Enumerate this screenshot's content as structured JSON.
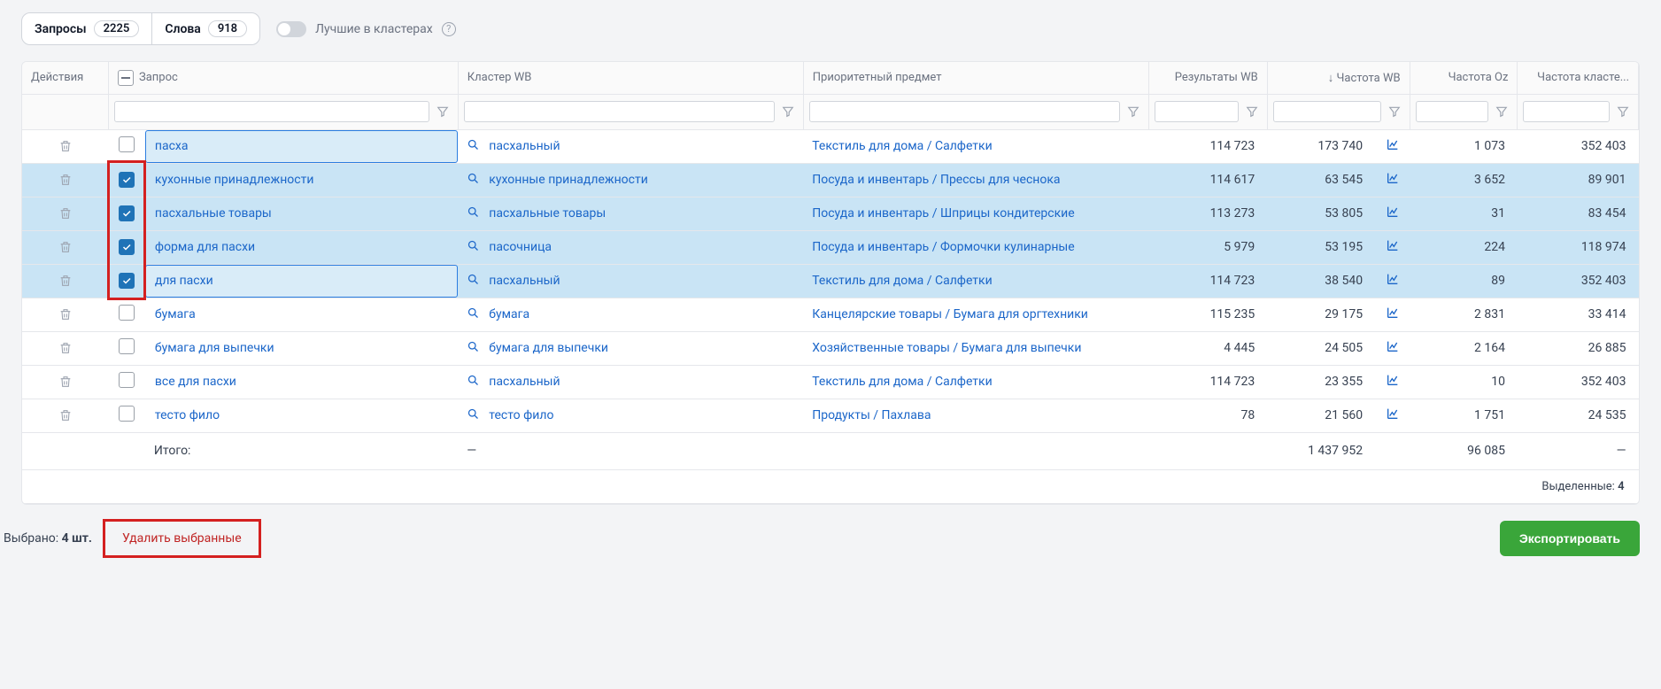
{
  "toolbar": {
    "queries_label": "Запросы",
    "queries_count": "2225",
    "words_label": "Слова",
    "words_count": "918",
    "best_in_clusters": "Лучшие в кластерах"
  },
  "headers": {
    "actions": "Действия",
    "query": "Запрос",
    "cluster": "Кластер WB",
    "subject": "Приоритетный предмет",
    "results_wb": "Результаты WB",
    "freq_wb": "↓ Частота WB",
    "freq_oz": "Частота Oz",
    "freq_cluster": "Частота класте..."
  },
  "rows": [
    {
      "checked": false,
      "focus": true,
      "query": "пасха",
      "cluster": "пасхальный",
      "subject": "Текстиль для дома / Салфетки",
      "res_wb": "114 723",
      "freq_wb": "173 740",
      "freq_oz": "1 073",
      "freq_cl": "352 403",
      "selected": false
    },
    {
      "checked": true,
      "focus": false,
      "query": "кухонные принадлежности",
      "cluster": "кухонные принадлежности",
      "subject": "Посуда и инвентарь / Прессы для чеснока",
      "res_wb": "114 617",
      "freq_wb": "63 545",
      "freq_oz": "3 652",
      "freq_cl": "89 901",
      "selected": true
    },
    {
      "checked": true,
      "focus": false,
      "query": "пасхальные товары",
      "cluster": "пасхальные товары",
      "subject": "Посуда и инвентарь / Шприцы кондитерские",
      "res_wb": "113 273",
      "freq_wb": "53 805",
      "freq_oz": "31",
      "freq_cl": "83 454",
      "selected": true
    },
    {
      "checked": true,
      "focus": false,
      "query": "форма для пасхи",
      "cluster": "пасочница",
      "subject": "Посуда и инвентарь / Формочки кулинарные",
      "res_wb": "5 979",
      "freq_wb": "53 195",
      "freq_oz": "224",
      "freq_cl": "118 974",
      "selected": true
    },
    {
      "checked": true,
      "focus": true,
      "query": "для пасхи",
      "cluster": "пасхальный",
      "subject": "Текстиль для дома / Салфетки",
      "res_wb": "114 723",
      "freq_wb": "38 540",
      "freq_oz": "89",
      "freq_cl": "352 403",
      "selected": true
    },
    {
      "checked": false,
      "focus": false,
      "query": "бумага",
      "cluster": "бумага",
      "subject": "Канцелярские товары / Бумага для оргтехники",
      "res_wb": "115 235",
      "freq_wb": "29 175",
      "freq_oz": "2 831",
      "freq_cl": "33 414",
      "selected": false
    },
    {
      "checked": false,
      "focus": false,
      "query": "бумага для выпечки",
      "cluster": "бумага для выпечки",
      "subject": "Хозяйственные товары / Бумага для выпечки",
      "res_wb": "4 445",
      "freq_wb": "24 505",
      "freq_oz": "2 164",
      "freq_cl": "26 885",
      "selected": false
    },
    {
      "checked": false,
      "focus": false,
      "query": "все для пасхи",
      "cluster": "пасхальный",
      "subject": "Текстиль для дома / Салфетки",
      "res_wb": "114 723",
      "freq_wb": "23 355",
      "freq_oz": "10",
      "freq_cl": "352 403",
      "selected": false
    },
    {
      "checked": false,
      "focus": false,
      "query": "тесто фило",
      "cluster": "тесто фило",
      "subject": "Продукты / Пахлава",
      "res_wb": "78",
      "freq_wb": "21 560",
      "freq_oz": "1 751",
      "freq_cl": "24 535",
      "selected": false
    }
  ],
  "totals": {
    "label": "Итого:",
    "dash": "—",
    "freq_wb": "1 437 952",
    "freq_oz": "96 085"
  },
  "selected_footer": {
    "label": "Выделенные:",
    "count": "4"
  },
  "footer": {
    "selected_label": "Выбрано:",
    "selected_count": "4 шт.",
    "delete_selected": "Удалить выбранные",
    "export": "Экспортировать"
  }
}
